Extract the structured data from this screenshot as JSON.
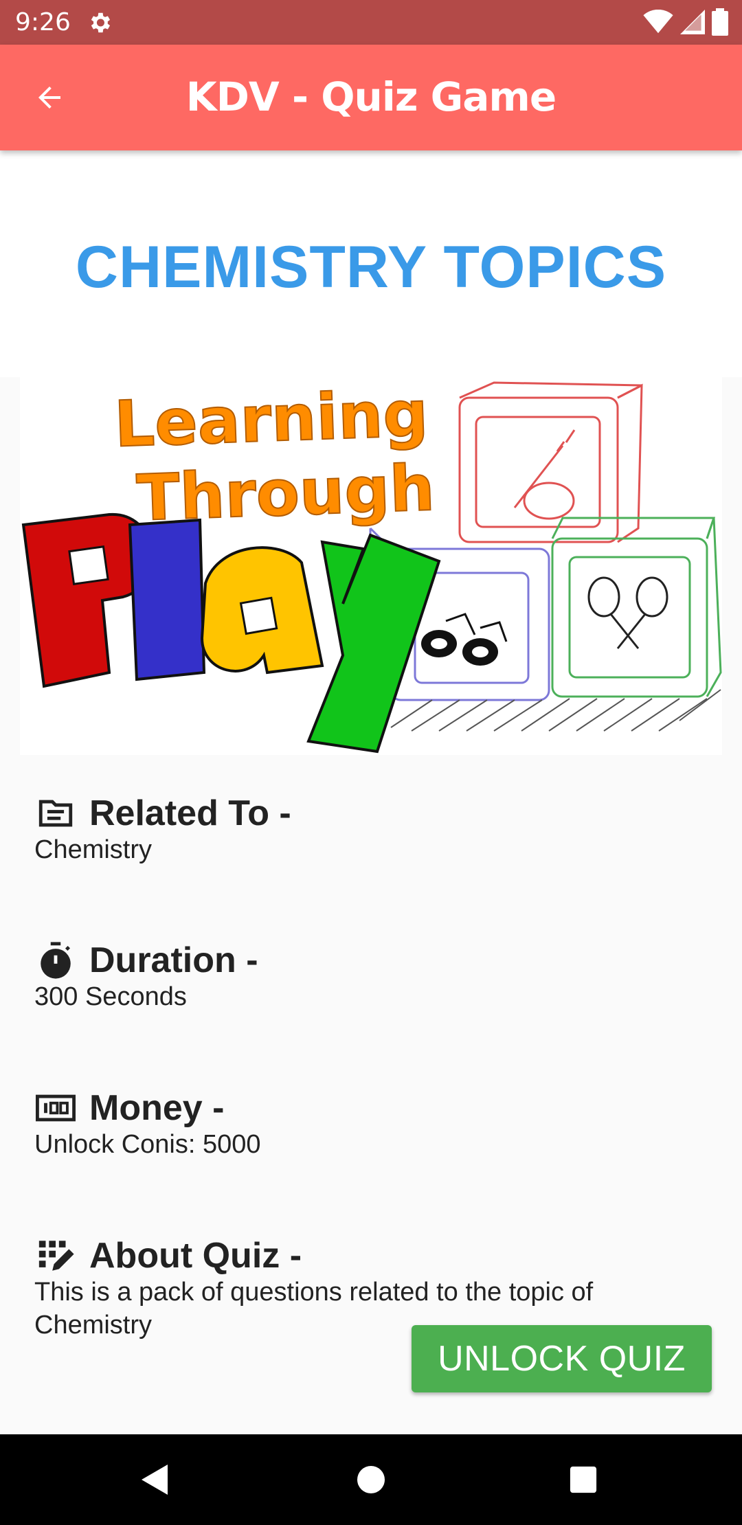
{
  "status_bar": {
    "time": "9:26",
    "icons": [
      "settings-icon",
      "wifi-icon",
      "signal-icon",
      "battery-icon"
    ]
  },
  "app_bar": {
    "title": "KDV - Quiz Game",
    "back_icon": "arrow-back-icon",
    "color": "#fe6963"
  },
  "page": {
    "heading": "CHEMISTRY TOPICS",
    "heading_color": "#3a9ae8"
  },
  "banner": {
    "line1": "Learning",
    "line2": "Through",
    "play_letters": [
      "P",
      "l",
      "a",
      "y"
    ],
    "play_colors": [
      "#d10a0a",
      "#3430c9",
      "#ffc400",
      "#11c41a"
    ],
    "text_color": "#ff8c00"
  },
  "info": {
    "related": {
      "title": "Related To -",
      "value": "Chemistry",
      "icon": "subject-icon"
    },
    "duration": {
      "title": "Duration -",
      "value": "300 Seconds",
      "icon": "timer-icon"
    },
    "money": {
      "title": "Money -",
      "value": "Unlock Conis: 5000",
      "icon": "money-icon"
    },
    "about": {
      "title": "About Quiz -",
      "value": "This is a pack of questions related to the topic of Chemistry",
      "icon": "quiz-icon"
    }
  },
  "unlock_button": {
    "label": "UNLOCK QUIZ",
    "color": "#4caf50"
  },
  "nav_bar": {
    "buttons": [
      "back-triangle-icon",
      "home-circle-icon",
      "recents-square-icon"
    ]
  }
}
